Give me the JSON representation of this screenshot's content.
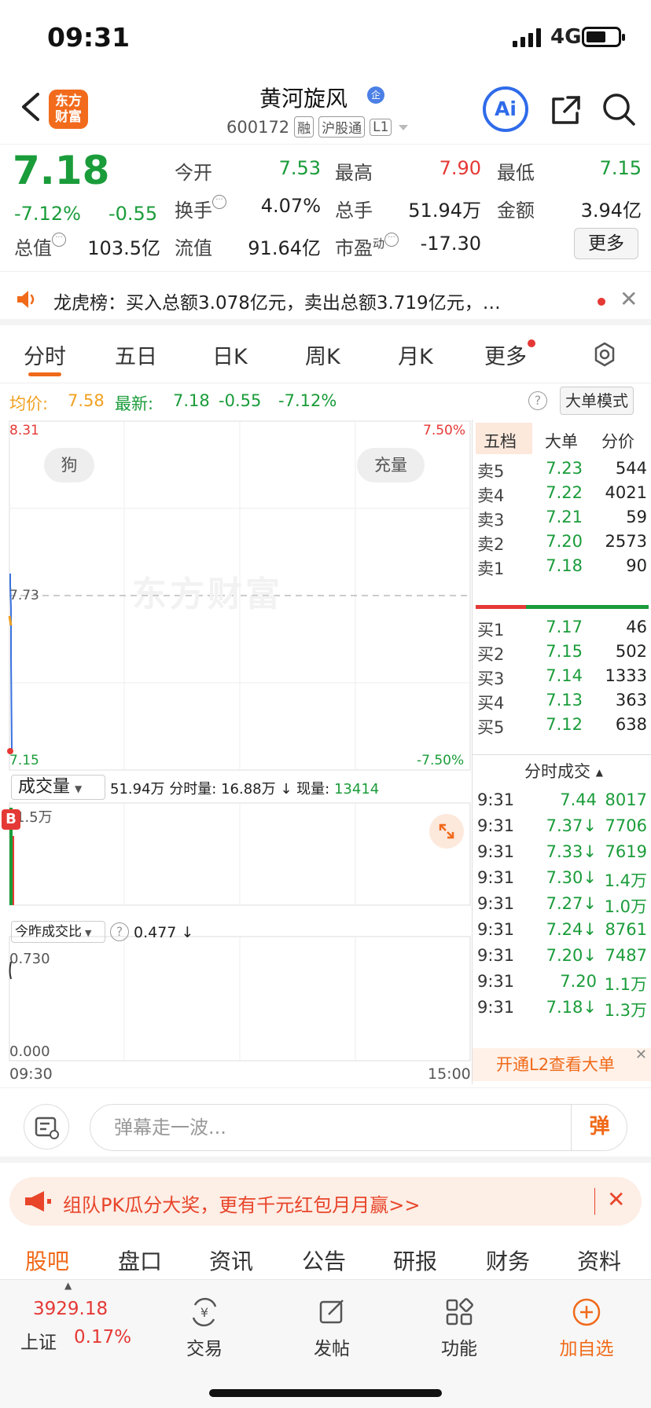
{
  "status": {
    "time": "09:31",
    "network": "4G"
  },
  "header": {
    "logo": [
      "东方",
      "财富"
    ],
    "title": "黄河旋风",
    "title_badge": "企",
    "code": "600172",
    "tags": [
      "融",
      "沪股通",
      "L1"
    ],
    "ai_label": "Ai"
  },
  "quote": {
    "price": "7.18",
    "pct": "-7.12%",
    "chg": "-0.55",
    "fields": [
      {
        "label": "今开",
        "value": "7.53",
        "color": "green"
      },
      {
        "label": "最高",
        "value": "7.90",
        "color": "red"
      },
      {
        "label": "最低",
        "value": "7.15",
        "color": "green"
      },
      {
        "label": "换手",
        "value": "4.07%",
        "color": "dark"
      },
      {
        "label": "总手",
        "value": "51.94万",
        "color": "dark"
      },
      {
        "label": "金额",
        "value": "3.94亿",
        "color": "dark"
      },
      {
        "label": "总值",
        "value": "103.5亿",
        "color": "dark"
      },
      {
        "label": "流值",
        "value": "91.64亿",
        "color": "dark"
      },
      {
        "label": "市盈",
        "label_sup": "动",
        "value": "-17.30",
        "color": "dark"
      }
    ],
    "more": "更多"
  },
  "notice": {
    "text": "龙虎榜：买入总额3.078亿元，卖出总额3.719亿元，…"
  },
  "tabs": [
    "分时",
    "五日",
    "日K",
    "周K",
    "月K",
    "更多"
  ],
  "avg_row": {
    "avg_label": "均价:",
    "avg_value": "7.58",
    "last_label": "最新:",
    "last_value": "7.18",
    "last_chg": "-0.55",
    "last_pct": "-7.12%",
    "mode_btn": "大单模式"
  },
  "chart": {
    "price_high": "8.31",
    "price_mid": "7.73",
    "price_low": "7.15",
    "pct_high": "7.50%",
    "pct_low": "-7.50%",
    "chip_left": "狗",
    "chip_right": "充量",
    "watermark": "东方财富",
    "vol_selector": "成交量",
    "vol_summary": "51.94万",
    "vol_min_label": "分时量:",
    "vol_min_value": "16.88万",
    "vol_now_label": "现量:",
    "vol_now_value": "13414",
    "vol_axis_max": "1.5万",
    "b_marker": "B",
    "ratio_selector": "今昨成交比",
    "ratio_value": "0.477",
    "ratio_max": "0.730",
    "ratio_min": "0.000",
    "time_start": "09:30",
    "time_end": "15:00"
  },
  "book": {
    "tabs": [
      "五档",
      "大单",
      "分价"
    ],
    "asks": [
      {
        "label": "卖5",
        "price": "7.23",
        "vol": "544"
      },
      {
        "label": "卖4",
        "price": "7.22",
        "vol": "4021"
      },
      {
        "label": "卖3",
        "price": "7.21",
        "vol": "59"
      },
      {
        "label": "卖2",
        "price": "7.20",
        "vol": "2573"
      },
      {
        "label": "卖1",
        "price": "7.18",
        "vol": "90"
      }
    ],
    "bids": [
      {
        "label": "买1",
        "price": "7.17",
        "vol": "46"
      },
      {
        "label": "买2",
        "price": "7.15",
        "vol": "502"
      },
      {
        "label": "买3",
        "price": "7.14",
        "vol": "1333"
      },
      {
        "label": "买4",
        "price": "7.13",
        "vol": "363"
      },
      {
        "label": "买5",
        "price": "7.12",
        "vol": "638"
      }
    ],
    "trades_title": "分时成交",
    "trades": [
      {
        "time": "9:31",
        "price": "7.44",
        "vol": "8017"
      },
      {
        "time": "9:31",
        "price": "7.37↓",
        "vol": "7706"
      },
      {
        "time": "9:31",
        "price": "7.33↓",
        "vol": "7619"
      },
      {
        "time": "9:31",
        "price": "7.30↓",
        "vol": "1.4万"
      },
      {
        "time": "9:31",
        "price": "7.27↓",
        "vol": "1.0万"
      },
      {
        "time": "9:31",
        "price": "7.24↓",
        "vol": "8761"
      },
      {
        "time": "9:31",
        "price": "7.20↓",
        "vol": "7487"
      },
      {
        "time": "9:31",
        "price": "7.20",
        "vol": "1.1万"
      },
      {
        "time": "9:31",
        "price": "7.18↓",
        "vol": "1.3万"
      }
    ],
    "l2_banner": "开通L2查看大单"
  },
  "comment": {
    "placeholder": "弹幕走一波...",
    "button": "弹"
  },
  "promo": {
    "text": "组队PK瓜分大奖，更有千元红包月月赢>>"
  },
  "sections": [
    "股吧",
    "盘口",
    "资讯",
    "公告",
    "研报",
    "财务",
    "资料"
  ],
  "nav": {
    "index_value": "3929.18",
    "index_name": "上证",
    "index_pct": "0.17%",
    "items": [
      "交易",
      "发帖",
      "功能",
      "加自选"
    ]
  },
  "colors": {
    "up": "#e53935",
    "down": "#1a9c3a",
    "accent": "#f06a1a",
    "ai": "#2f6bea"
  }
}
